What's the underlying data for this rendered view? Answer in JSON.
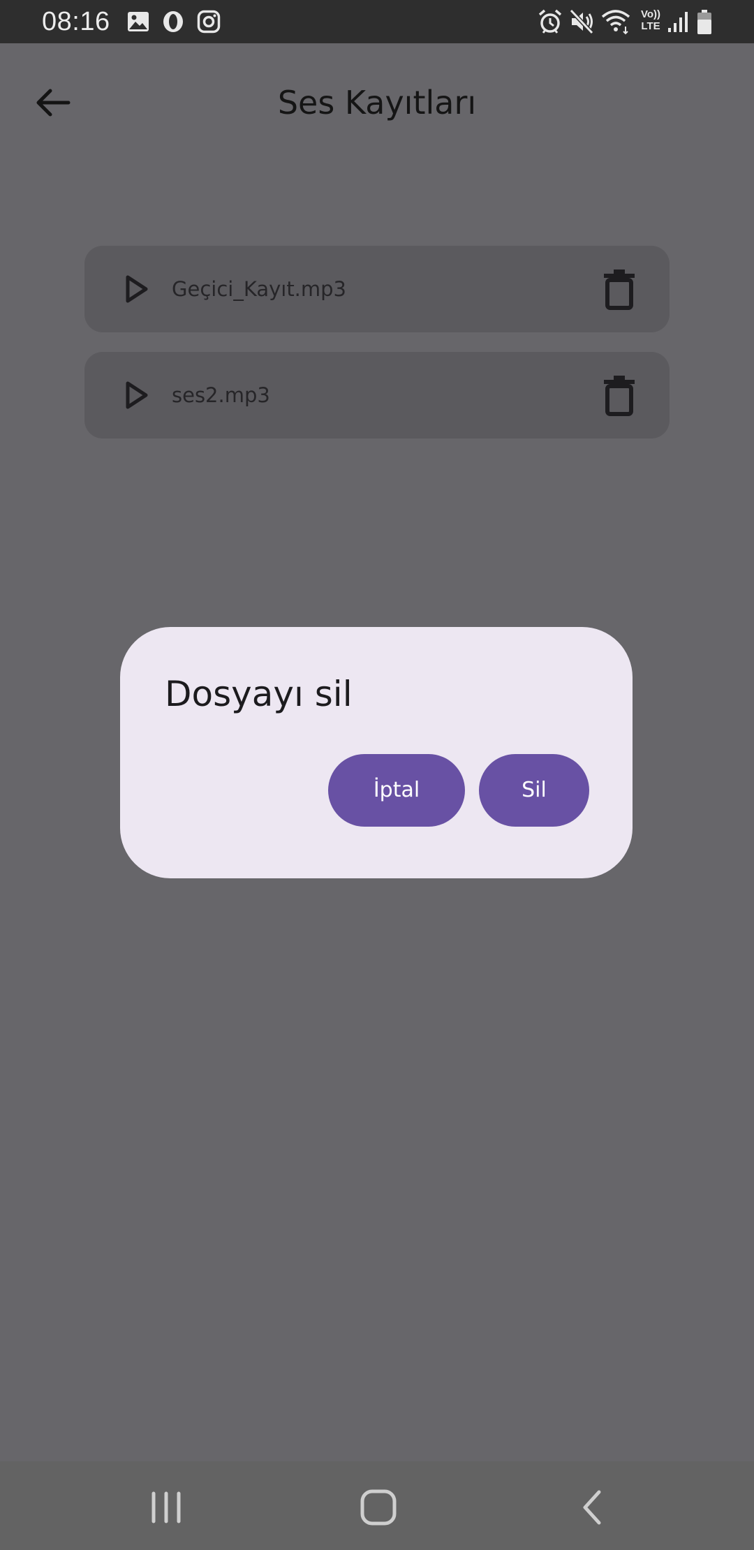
{
  "status_bar": {
    "time": "08:16",
    "left_icons": [
      "gallery-icon",
      "opera-icon",
      "instagram-icon"
    ],
    "right_icons": [
      "alarm-icon",
      "mute-icon",
      "wifi-icon",
      "volte-icon",
      "signal-icon",
      "battery-icon"
    ],
    "volte_top": "Vo))",
    "volte_bottom": "LTE"
  },
  "header": {
    "title": "Ses Kayıtları",
    "back_icon": "arrow-back-icon"
  },
  "recordings": [
    {
      "name": "Geçici_Kayıt.mp3",
      "play_icon": "play-icon",
      "delete_icon": "trash-icon"
    },
    {
      "name": "ses2.mp3",
      "play_icon": "play-icon",
      "delete_icon": "trash-icon"
    }
  ],
  "dialog": {
    "title": "Dosyayı sil",
    "cancel_label": "İptal",
    "confirm_label": "Sil"
  },
  "nav_bar": {
    "buttons": [
      "recents-icon",
      "home-icon",
      "back-icon"
    ]
  },
  "colors": {
    "scrim": "#67666a",
    "status_bar": "#2e2e2e",
    "card": "#5b5a5e",
    "dialog_bg": "#ede7f2",
    "accent": "#6851a4",
    "nav_bar": "#636363"
  }
}
